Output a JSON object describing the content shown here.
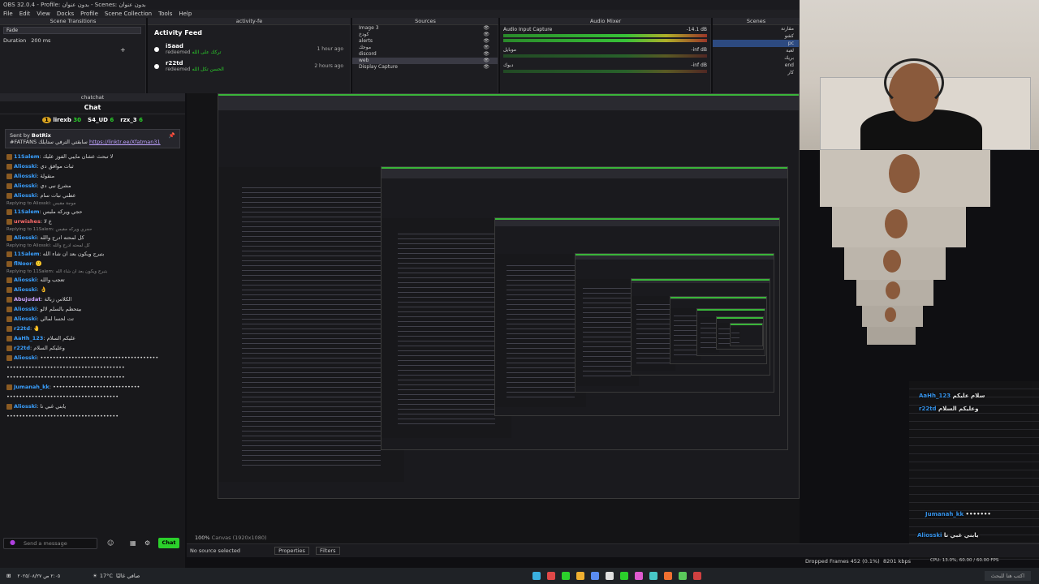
{
  "window": {
    "title": "OBS 32.0.4 - Profile: بدون عنوان - Scenes: بدون عنوان",
    "menu": [
      "File",
      "Edit",
      "View",
      "Docks",
      "Profile",
      "Scene Collection",
      "Tools",
      "Help"
    ]
  },
  "docks": {
    "scene_transitions": "Scene Transitions",
    "activity": "activity-fe",
    "sources": "Sources",
    "mixer": "Audio Mixer",
    "scenes": "Scenes"
  },
  "transitions": {
    "type": "Fade",
    "duration_label": "Duration",
    "duration_value": "200 ms"
  },
  "activity_feed": {
    "title": "Activity Feed",
    "items": [
      {
        "name": "iSaad",
        "action": "redeemed",
        "reward": "تركك على الله",
        "time": "1 hour ago"
      },
      {
        "name": "r22td",
        "action": "redeemed",
        "reward": "الحسن تكل الله",
        "time": "2 hours ago"
      }
    ]
  },
  "sources": {
    "items": [
      "Image 3",
      "كودخ",
      "alerts",
      "موجك",
      "discord",
      "web",
      "Display Capture"
    ],
    "selected": 5
  },
  "mixer": {
    "channels": [
      {
        "name": "Audio Input Capture",
        "db": "-14.1 dB"
      },
      {
        "name": "موبايل",
        "db": "-inf dB"
      },
      {
        "name": "دبوك",
        "db": "-inf dB"
      }
    ]
  },
  "scenes": {
    "items": [
      "مقارنة",
      "كشو",
      "pc",
      "لعبة",
      "بريك",
      "end",
      "كار"
    ],
    "selected": 2
  },
  "chat": {
    "dock_title": "chatchat",
    "title": "Chat",
    "gifters": [
      {
        "rank": "1",
        "name": "lirexb",
        "count": "30"
      },
      {
        "name": "S4_UD",
        "count": "6"
      },
      {
        "name": "rzx_3",
        "count": "6"
      }
    ],
    "pinned": {
      "sent_by": "Sent by",
      "bot": "BotRix",
      "text": "#FATFANS سابقتي الترفي ستايلك",
      "link": "https://linktr.ee/Xfatman31"
    },
    "messages": [
      {
        "user": "11Salem",
        "text": "لا تبحث عشان مايبي الفوز عليك",
        "color": "#3aa0ff"
      },
      {
        "user": "Aliosski",
        "text": "ثبات موافق دي",
        "color": "#3aa0ff"
      },
      {
        "user": "Aliosski",
        "text": "منقولة",
        "color": "#3aa0ff"
      },
      {
        "user": "Aliosski",
        "text": "مشرع نبي دي",
        "color": "#3aa0ff"
      },
      {
        "user": "Aliosski",
        "text": "عطني نبات سام",
        "color": "#3aa0ff"
      },
      {
        "reply": "Replying to Aliosski: موجة مقبس"
      },
      {
        "user": "11Salem",
        "text": "حجي ويركه ملبس",
        "color": "#3aa0ff"
      },
      {
        "user": "urwishes",
        "text": "ع لا",
        "color": "#ff6b6b"
      },
      {
        "reply": "Replying to 11Salem: حجري ويركه مقبس"
      },
      {
        "user": "Aliosski",
        "text": "كل لمحته ادرج والله",
        "color": "#3aa0ff"
      },
      {
        "reply": "Replying to Aliosski: كل لمحته ادرج والله"
      },
      {
        "user": "11Salem",
        "text": "بتبرج ويكون بعد ان شاء الله",
        "color": "#3aa0ff"
      },
      {
        "user": "flNoor",
        "text": "🙂",
        "color": "#3aa0ff"
      },
      {
        "reply": "Replying to 11Salem: بتبرج ويكون بعد ان شاء الله"
      },
      {
        "user": "Aliosski",
        "text": "تعجب والله",
        "color": "#3aa0ff"
      },
      {
        "user": "Aliosski",
        "text": "👌",
        "color": "#3aa0ff"
      },
      {
        "user": "Abujudat",
        "text": "الكلاس زبالة",
        "color": "#c8a2ff"
      },
      {
        "user": "Aliosski",
        "text": "بيتحطم بالسلم لالو",
        "color": "#3aa0ff"
      },
      {
        "user": "Aliosski",
        "text": "تت لحسا لمالي",
        "color": "#3aa0ff"
      },
      {
        "user": "r22td",
        "text": "🤚",
        "color": "#3aa0ff"
      },
      {
        "user": "AaHh_123",
        "text": "عليكم السلام",
        "color": "#3aa0ff"
      },
      {
        "user": "r22td",
        "text": "وعليكم السلام",
        "color": "#3aa0ff"
      },
      {
        "user": "Aliosski",
        "text": "••••••••••••••••••••••••••••••••••••••",
        "color": "#3aa0ff"
      },
      {
        "user": "",
        "text": "••••••••••••••••••••••••••••••••••••••",
        "color": "#ccc"
      },
      {
        "user": "",
        "text": "••••••••••••••••••••••••••••••••••••••",
        "color": "#ccc"
      },
      {
        "user": "Jumanah_kk",
        "text": "••••••••••••••••••••••••••••",
        "color": "#3aa0ff"
      },
      {
        "user": "",
        "text": "••••••••••••••••••••••••••••••••••••",
        "color": "#ccc"
      },
      {
        "user": "Aliosski",
        "text": "يابني غبي نا",
        "color": "#3aa0ff"
      },
      {
        "user": "",
        "text": "••••••••••••••••••••••••••••••••••••",
        "color": "#ccc"
      }
    ],
    "input_placeholder": "Send a message",
    "send_label": "Chat"
  },
  "webcam_overlay": [
    {
      "user": "AaHh_123",
      "text": "سلام عليكم"
    },
    {
      "user": "r22td",
      "text": "وعليكم السلام"
    },
    {
      "user": "Aliosski",
      "text": "يابني غبي نا"
    },
    {
      "user": "Jumanah_kk",
      "text": "•••••••"
    }
  ],
  "statusbar": {
    "zoom": "100%",
    "canvas": "Canvas (1920x1080)",
    "no_source": "No source selected",
    "properties": "Properties",
    "filters": "Filters",
    "dropped": "Dropped Frames 452 (0.1%)",
    "kbps": "8201 kbps",
    "cpu": "CPU: 13.0%, 60.00 / 60.00 FPS"
  },
  "taskbar": {
    "weather": "17°C",
    "weather_desc": "صافي غالبًا",
    "time": "٢:٠٥ ص",
    "date": "٢٠٢٥/٠٨/٢٧",
    "search": "اكتب هنا للبحث",
    "icon_colors": [
      "#3ab0e0",
      "#e04848",
      "#2bd02b",
      "#f0b030",
      "#5a8cf0",
      "#e0e0e0",
      "#2bd02b",
      "#e05ad0",
      "#48c8c8",
      "#f07030",
      "#5ac85a",
      "#d04040"
    ]
  },
  "colors": {
    "accent_green": "#2bd02b",
    "obs_bg": "#1d1d21"
  }
}
